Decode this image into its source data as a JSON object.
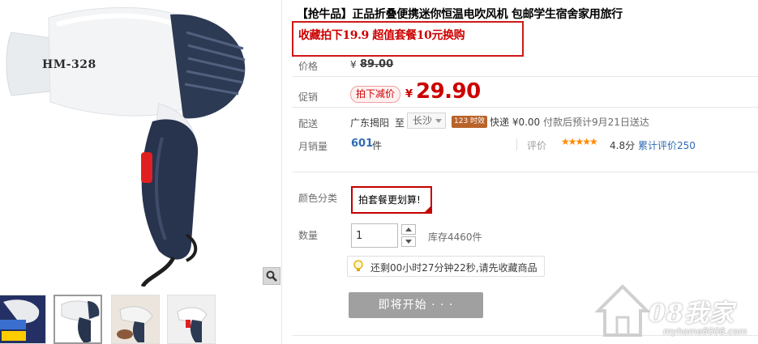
{
  "product": {
    "title": "【抢牛品】正品折叠便携迷你恒温电吹风机 包邮学生宿舍家用旅行",
    "promo_banner": "收藏拍下19.9 超值套餐10元换购",
    "model_text": "HM-328"
  },
  "price": {
    "label": "价格",
    "currency": "¥",
    "original": "89.00"
  },
  "promo": {
    "label": "促销",
    "tag": "拍下减价",
    "currency": "¥",
    "price": "29.90"
  },
  "shipping": {
    "label": "配送",
    "from": "广东揭阳",
    "to_word": "至",
    "city": "长沙",
    "time_badge": "123 时效",
    "courier": "快递 ¥0.00",
    "eta": "付款后预计9月21日送达"
  },
  "sales": {
    "label": "月销量",
    "count": "601",
    "unit": "件",
    "rating_label": "评价",
    "stars": "★★★★★",
    "score": "4.8分",
    "review_link": "累计评价250"
  },
  "sku": {
    "label": "颜色分类",
    "option": "拍套餐更划算!"
  },
  "quantity": {
    "label": "数量",
    "value": "1",
    "stock": "库存4460件"
  },
  "timer": {
    "text": "还剩00小时27分钟22秒,请先收藏商品"
  },
  "actions": {
    "start": "即将开始 · · ·"
  },
  "watermark": {
    "logo": "08我家",
    "url": "myhome8008.com"
  },
  "colors": {
    "price_red": "#c40000",
    "link_blue": "#2e6bb3",
    "star_orange": "#ff8a00",
    "button_gray": "#a0a0a0"
  }
}
